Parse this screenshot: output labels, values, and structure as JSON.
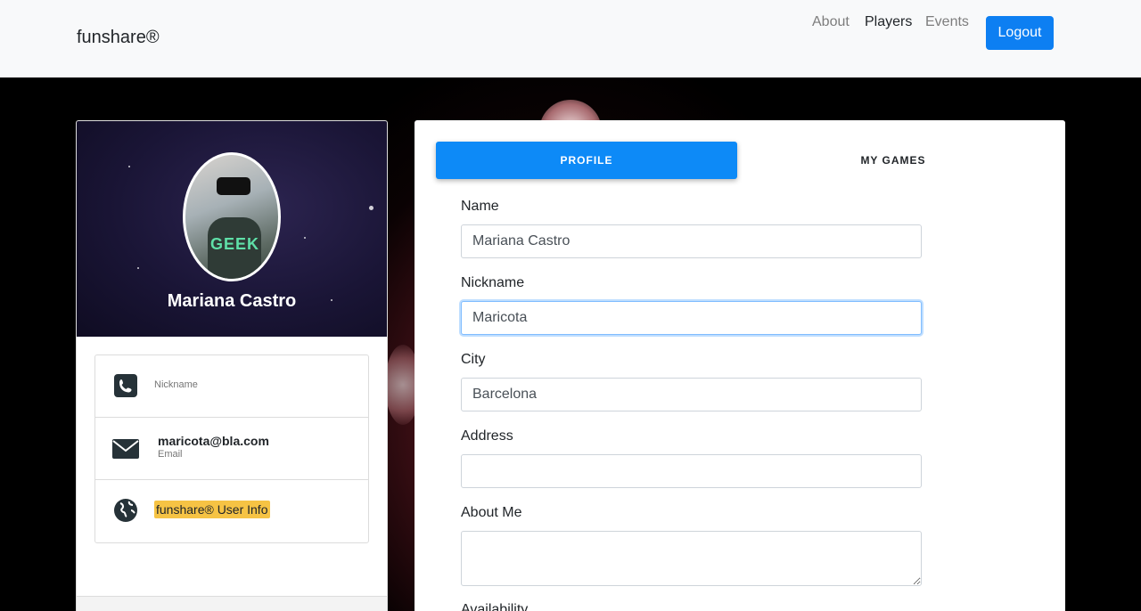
{
  "navbar": {
    "brand": "funshare®",
    "links": [
      {
        "label": "About",
        "active": false
      },
      {
        "label": "Players",
        "active": true
      },
      {
        "label": "Events",
        "active": false
      }
    ],
    "logout_label": "Logout"
  },
  "profile_card": {
    "name": "Mariana Castro",
    "avatar_shirt_text": "GEEK",
    "items": [
      {
        "icon": "phone-icon",
        "small_label": "Nickname"
      },
      {
        "icon": "envelope-icon",
        "value": "maricota@bla.com",
        "sub": "Email"
      },
      {
        "icon": "globe-icon",
        "highlight": "funshare® User Info"
      }
    ]
  },
  "tabs": {
    "profile": "PROFILE",
    "games": "MY GAMES"
  },
  "form": {
    "name_label": "Name",
    "name_value": "Mariana Castro",
    "nickname_label": "Nickname",
    "nickname_value": "Maricota",
    "city_label": "City",
    "city_value": "Barcelona",
    "address_label": "Address",
    "address_value": "",
    "about_label": "About Me",
    "availability_label": "Availability"
  },
  "colors": {
    "primary": "#0d7ff2",
    "highlight": "#f6c344"
  }
}
